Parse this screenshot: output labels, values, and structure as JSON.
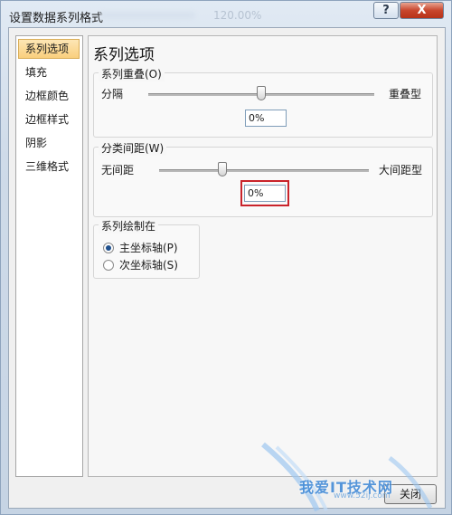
{
  "window": {
    "title": "设置数据系列格式",
    "title_ghost": "120.00%",
    "help_glyph": "?",
    "close_glyph": "X"
  },
  "nav": {
    "items": [
      {
        "label": "系列选项",
        "active": true
      },
      {
        "label": "填充"
      },
      {
        "label": "边框颜色"
      },
      {
        "label": "边框样式"
      },
      {
        "label": "阴影"
      },
      {
        "label": "三维格式"
      }
    ]
  },
  "panel": {
    "title": "系列选项",
    "overlap": {
      "label": "系列重叠(O)",
      "left_label": "分隔",
      "right_label": "重叠型",
      "value": "0%",
      "slider_fraction": 0.5
    },
    "gap": {
      "label": "分类间距(W)",
      "left_label": "无间距",
      "right_label": "大间距型",
      "value": "0%",
      "slider_fraction": 0.3
    },
    "plot_on": {
      "label": "系列绘制在",
      "options": [
        {
          "label": "主坐标轴(P)",
          "checked": true
        },
        {
          "label": "次坐标轴(S)",
          "checked": false
        }
      ]
    }
  },
  "footer": {
    "close_label": "关闭"
  },
  "watermark": {
    "text": "我爱IT技术网",
    "url": "www.52ij.com"
  },
  "colors": {
    "highlight": "#c9232b",
    "nav_active": "#f9cf7d",
    "close_red": "#c8462d"
  }
}
